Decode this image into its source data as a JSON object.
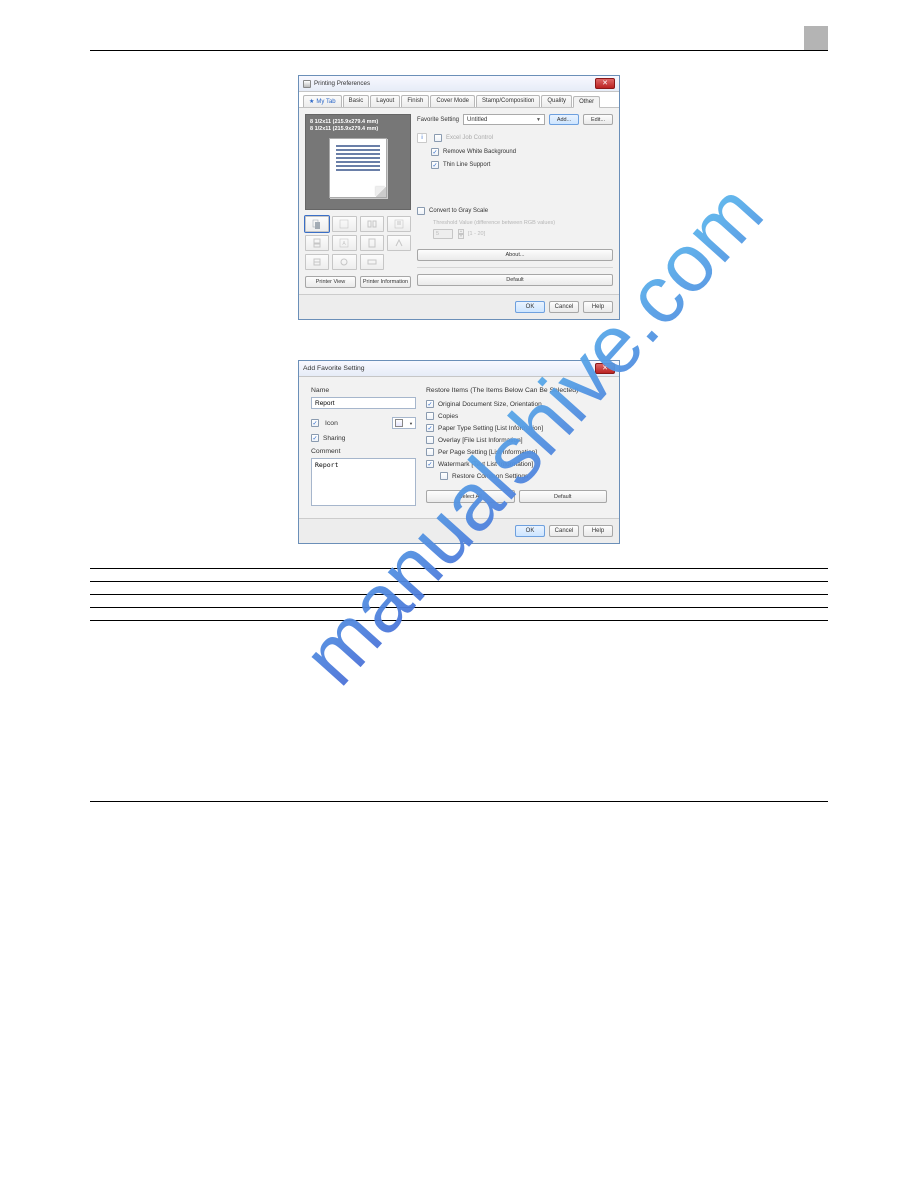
{
  "dialog1": {
    "title": "Printing Preferences",
    "tabs": [
      "My Tab",
      "Basic",
      "Layout",
      "Finish",
      "Cover Mode",
      "Stamp/Composition",
      "Quality",
      "Other"
    ],
    "active_tab": "Other",
    "preview": {
      "line1": "8 1/2x11 (215.9x279.4 mm)",
      "line2": "8 1/2x11 (215.9x279.4 mm)"
    },
    "printer_view": "Printer View",
    "printer_info": "Printer Information",
    "favorite_setting_label": "Favorite Setting",
    "favorite_selected": "Untitled",
    "add": "Add...",
    "edit": "Edit...",
    "excel": "Excel Job Control",
    "remove_white": "Remove White Background",
    "thin_line": "Thin Line Support",
    "convert_gray": "Convert to Gray Scale",
    "threshold_label": "Threshold Value (difference between RGB values)",
    "threshold_value": "5",
    "threshold_range": "[1 - 20]",
    "about": "About...",
    "default": "Default",
    "ok": "OK",
    "cancel": "Cancel",
    "help": "Help"
  },
  "dialog2": {
    "title": "Add Favorite Setting",
    "name_label": "Name",
    "name_value": "Report",
    "icon_label": "Icon",
    "sharing_label": "Sharing",
    "comment_label": "Comment",
    "comment_value": "Report",
    "restore_heading": "Restore Items (The Items Below Can Be Selected)",
    "item_orig": "Original Document Size, Orientation",
    "item_copies": "Copies",
    "item_papertype": "Paper Type Setting [List Information]",
    "item_overlay": "Overlay [File List Information]",
    "item_perpage": "Per Page Setting [List Information]",
    "item_watermark": "Watermark [Text List Information]",
    "item_restorecommon": "Restore Common Settings",
    "select_all": "Select All",
    "default": "Default",
    "ok": "OK",
    "cancel": "Cancel",
    "help": "Help"
  },
  "table": {
    "r1c1": " ",
    "r1c2": " ",
    "r2c1": " ",
    "r2c2": " ",
    "r3c1": " ",
    "r3c2": " ",
    "r4c1": " ",
    "r4c2": " "
  }
}
